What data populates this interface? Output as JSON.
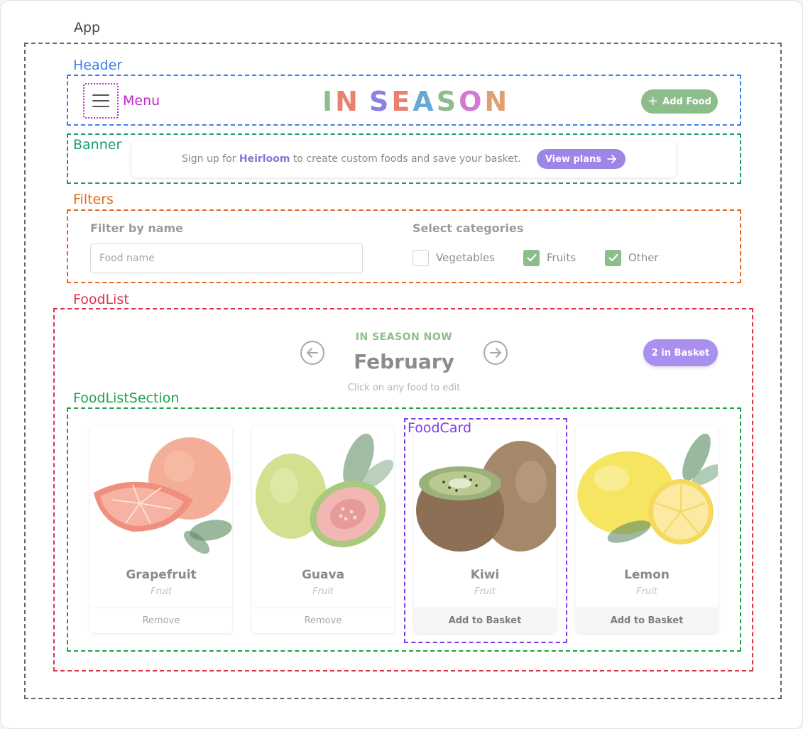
{
  "annotations": {
    "app": "App",
    "header": "Header",
    "menu": "Menu",
    "banner": "Banner",
    "filters": "Filters",
    "foodlist": "FoodList",
    "foodlist_section": "FoodListSection",
    "foodcard": "FoodCard"
  },
  "annotation_colors": {
    "app": "#666666",
    "header": "#3b82e6",
    "menu": "#c026d3",
    "banner": "#1a9a7a",
    "filters": "#e8651a",
    "foodlist": "#e0304a",
    "foodlist_section": "#1aa34a",
    "foodcard": "#7c3aed"
  },
  "header": {
    "logo_letters": [
      "I",
      "N",
      " ",
      "S",
      "E",
      "A",
      "S",
      "O",
      "N"
    ],
    "logo_colors": [
      "#8dbd8a",
      "#e98070",
      "#ffffff",
      "#8b80e6",
      "#e98070",
      "#66a9d6",
      "#8dbd8a",
      "#d07ad4",
      "#e0a070"
    ],
    "logo_text": "IN SEASON",
    "menu_icon": "hamburger-icon",
    "add_food_label": "Add Food"
  },
  "banner": {
    "text_before": "Sign up for",
    "brand": "Heirloom",
    "text_after": "to create custom foods and save your basket.",
    "button_label": "View plans"
  },
  "filters": {
    "name_title": "Filter by name",
    "name_placeholder": "Food name",
    "name_value": "",
    "categories_title": "Select categories",
    "categories": [
      {
        "label": "Vegetables",
        "checked": false
      },
      {
        "label": "Fruits",
        "checked": true
      },
      {
        "label": "Other",
        "checked": true
      }
    ]
  },
  "foodlist": {
    "season_label": "IN SEASON NOW",
    "month": "February",
    "hint": "Click on any food to edit",
    "basket_label": "2 in Basket",
    "cards": [
      {
        "name": "Grapefruit",
        "type": "Fruit",
        "action": "Remove",
        "in_basket": true,
        "image": "grapefruit-image"
      },
      {
        "name": "Guava",
        "type": "Fruit",
        "action": "Remove",
        "in_basket": true,
        "image": "guava-image"
      },
      {
        "name": "Kiwi",
        "type": "Fruit",
        "action": "Add to Basket",
        "in_basket": false,
        "image": "kiwi-image"
      },
      {
        "name": "Lemon",
        "type": "Fruit",
        "action": "Add to Basket",
        "in_basket": false,
        "image": "lemon-image"
      }
    ]
  }
}
